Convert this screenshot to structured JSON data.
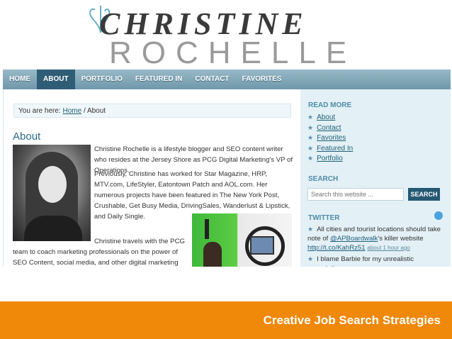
{
  "logo": {
    "line1": "CHRISTINE",
    "line2": "ROCHELLE"
  },
  "nav": {
    "items": [
      {
        "label": "HOME"
      },
      {
        "label": "ABOUT"
      },
      {
        "label": "PORTFOLIO"
      },
      {
        "label": "FEATURED IN"
      },
      {
        "label": "CONTACT"
      },
      {
        "label": "FAVORITES"
      }
    ]
  },
  "breadcrumb": {
    "prefix": "You are here:",
    "home": "Home",
    "separator": "/",
    "current": "About"
  },
  "main": {
    "title": "About",
    "p1": "Christine Rochelle is a lifestyle blogger and SEO content writer who resides at the Jersey Shore as PCG Digital Marketing's VP of Operations.",
    "p2": "Previously, Christine has worked for Star Magazine, HRP, MTV.com, LifeStyler, Eatontown Patch and AOL.com. Her numerous projects have been featured in The New York Post, Crushable, Get Busy Media, DrivingSales, Wanderlust & Lipstick, and Daily Single.",
    "p3": "Christine travels with the PCG",
    "p4": "team to coach marketing professionals on the power of SEO Content, social media, and other digital marketing strategies. For"
  },
  "sidebar": {
    "read_more": {
      "heading": "READ MORE",
      "items": [
        "About",
        "Contact",
        "Favorites",
        "Featured In",
        "Portfolio"
      ]
    },
    "search": {
      "heading": "SEARCH",
      "placeholder": "Search this website ...",
      "button": "SEARCH"
    },
    "twitter": {
      "heading": "TWITTER",
      "tweet1": {
        "text1": "All cities and tourist locations should take note of",
        "mention": "@APBoardwalk",
        "text2": "'s killer website",
        "link": "http://t.co/KahRz51",
        "time": "about 1 hour ago"
      },
      "tweet2": {
        "text": "I blame Barbie for my unrealistic expectations"
      }
    }
  },
  "banner": {
    "text": "Creative Job Search Strategies",
    "color": "#f0880a"
  }
}
